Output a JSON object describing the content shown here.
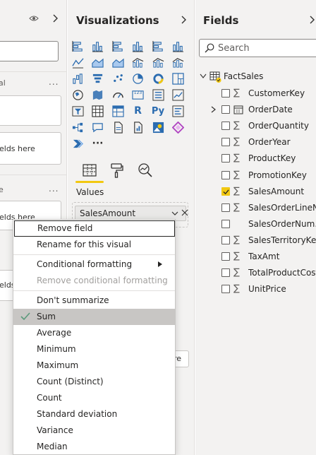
{
  "filters_pane": {
    "label_1": "al",
    "label_2": "e",
    "card_1_text": "elds here",
    "card_2_text": "elds here",
    "card_3_text": "elds",
    "more": "..."
  },
  "visualizations": {
    "title": "Visualizations",
    "icons": [
      "stacked-bar-chart-icon",
      "stacked-column-chart-icon",
      "clustered-bar-chart-icon",
      "clustered-column-chart-icon",
      "100-stacked-bar-chart-icon",
      "100-stacked-column-chart-icon",
      "line-chart-icon",
      "area-chart-icon",
      "stacked-area-chart-icon",
      "line-clustered-column-icon",
      "line-stacked-column-icon",
      "ribbon-chart-icon",
      "waterfall-chart-icon",
      "funnel-chart-icon",
      "scatter-chart-icon",
      "pie-chart-icon",
      "donut-chart-icon",
      "treemap-icon",
      "map-icon",
      "filled-map-icon",
      "gauge-icon",
      "card-icon",
      "multi-row-card-icon",
      "kpi-icon",
      "slicer-icon",
      "table-icon",
      "matrix-icon",
      "r-visual-icon",
      "python-visual-icon",
      "key-influencers-icon",
      "decomposition-tree-icon",
      "qa-icon",
      "paginated-report-icon",
      "smart-narrative-icon",
      "arcgis-map-icon",
      "power-apps-icon",
      "power-automate-icon",
      "more-visuals-icon"
    ],
    "r_label": "R",
    "py_label": "Py",
    "kpi_label": "123",
    "more_label": "···",
    "values_label": "Values",
    "chip_label": "SalesAmount",
    "ghost_text": "re"
  },
  "fields": {
    "title": "Fields",
    "search_placeholder": "Search",
    "table_name": "FactSales",
    "items": [
      {
        "name": "CustomerKey",
        "icon": "sigma",
        "checked": false
      },
      {
        "name": "OrderDate",
        "icon": "calendar",
        "checked": false,
        "expandable": true
      },
      {
        "name": "OrderQuantity",
        "icon": "sigma",
        "checked": false
      },
      {
        "name": "OrderYear",
        "icon": "sigma",
        "checked": false
      },
      {
        "name": "ProductKey",
        "icon": "sigma",
        "checked": false
      },
      {
        "name": "PromotionKey",
        "icon": "sigma",
        "checked": false
      },
      {
        "name": "SalesAmount",
        "icon": "sigma",
        "checked": true
      },
      {
        "name": "SalesOrderLineN...",
        "icon": "sigma",
        "checked": false
      },
      {
        "name": "SalesOrderNum...",
        "icon": "none",
        "checked": false
      },
      {
        "name": "SalesTerritoryKey",
        "icon": "sigma",
        "checked": false
      },
      {
        "name": "TaxAmt",
        "icon": "sigma",
        "checked": false
      },
      {
        "name": "TotalProductCost",
        "icon": "sigma",
        "checked": false
      },
      {
        "name": "UnitPrice",
        "icon": "sigma",
        "checked": false
      }
    ]
  },
  "context_menu": {
    "remove_field": "Remove field",
    "rename": "Rename for this visual",
    "conditional_formatting": "Conditional formatting",
    "remove_conditional_formatting": "Remove conditional formatting",
    "dont_summarize": "Don't summarize",
    "sum": "Sum",
    "average": "Average",
    "minimum": "Minimum",
    "maximum": "Maximum",
    "count_distinct": "Count (Distinct)",
    "count": "Count",
    "std_dev": "Standard deviation",
    "variance": "Variance",
    "median": "Median"
  },
  "colors": {
    "accent": "#f2c811",
    "viz_blue": "#2b6cb0",
    "check_green": "#5b9a7b"
  }
}
